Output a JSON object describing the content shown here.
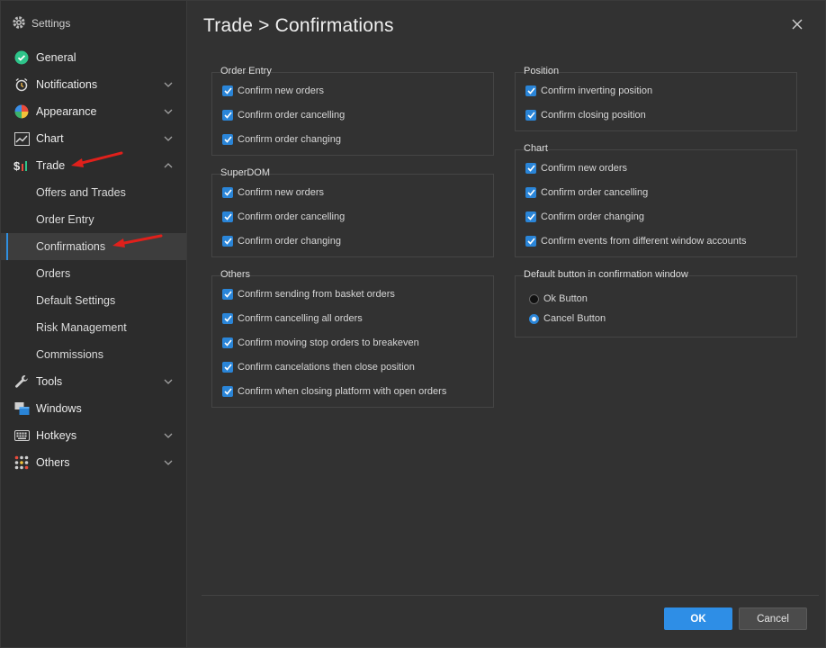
{
  "sidebar": {
    "title": "Settings",
    "items": [
      {
        "label": "General",
        "icon": "check-circle-icon"
      },
      {
        "label": "Notifications",
        "icon": "alarm-clock-icon"
      },
      {
        "label": "Appearance",
        "icon": "color-wheel-icon"
      },
      {
        "label": "Chart",
        "icon": "line-chart-icon"
      },
      {
        "label": "Trade",
        "icon": "dollar-chart-icon"
      },
      {
        "label": "Tools",
        "icon": "wrench-icon"
      },
      {
        "label": "Windows",
        "icon": "windows-stack-icon"
      },
      {
        "label": "Hotkeys",
        "icon": "keyboard-icon"
      },
      {
        "label": "Others",
        "icon": "grid-dots-icon"
      }
    ],
    "trade_subitems": [
      {
        "label": "Offers and Trades"
      },
      {
        "label": "Order Entry"
      },
      {
        "label": "Confirmations",
        "active": true
      },
      {
        "label": "Orders"
      },
      {
        "label": "Default Settings"
      },
      {
        "label": "Risk Management"
      },
      {
        "label": "Commissions"
      }
    ]
  },
  "page": {
    "title": "Trade > Confirmations"
  },
  "groups": {
    "order_entry": {
      "title": "Order Entry",
      "options": [
        "Confirm new orders",
        "Confirm order cancelling",
        "Confirm order changing"
      ]
    },
    "superdom": {
      "title": "SuperDOM",
      "options": [
        "Confirm new orders",
        "Confirm order cancelling",
        "Confirm order changing"
      ]
    },
    "others": {
      "title": "Others",
      "options": [
        "Confirm sending from basket orders",
        "Confirm cancelling all orders",
        "Confirm moving stop orders to breakeven",
        "Confirm cancelations then close position",
        "Confirm when closing platform with open orders"
      ]
    },
    "position": {
      "title": "Position",
      "options": [
        "Confirm inverting position",
        "Confirm closing position"
      ]
    },
    "chart": {
      "title": "Chart",
      "options": [
        "Confirm new orders",
        "Confirm order cancelling",
        "Confirm order changing",
        "Confirm events from different window accounts"
      ]
    },
    "default_button": {
      "title": "Default button in confirmation window",
      "options": [
        "Ok Button",
        "Cancel Button"
      ],
      "selected": "Cancel Button"
    }
  },
  "footer": {
    "ok_label": "OK",
    "cancel_label": "Cancel"
  },
  "colors": {
    "accent": "#2a85d8",
    "annotation_arrow": "#e0201b"
  }
}
